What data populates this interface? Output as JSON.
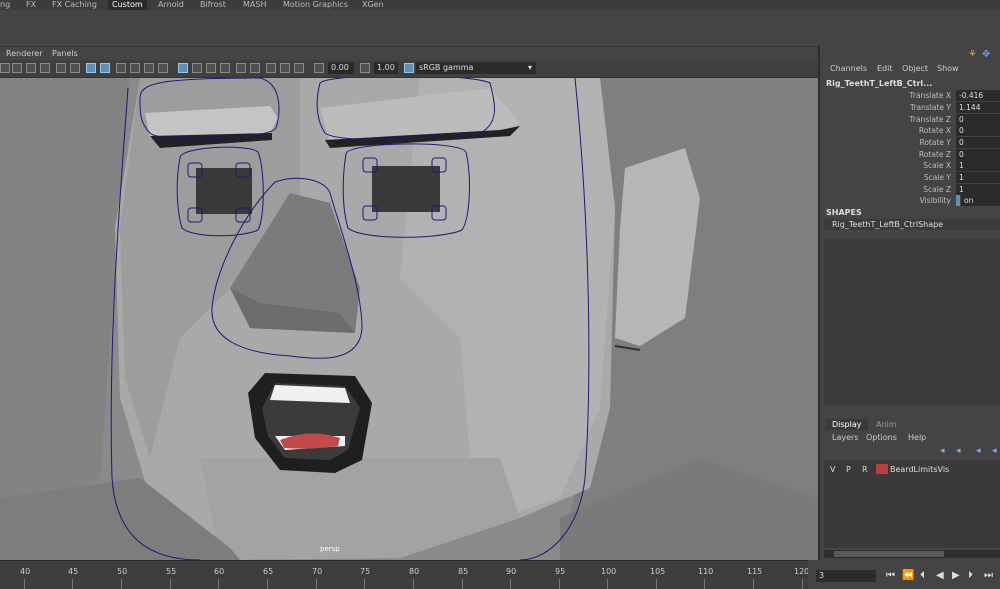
{
  "shelf_tabs": [
    "ng",
    "FX",
    "FX Caching",
    "Custom",
    "Arnold",
    "Bifrost",
    "MASH",
    "Motion Graphics",
    "XGen"
  ],
  "shelf_active": "Custom",
  "viewport_menu": [
    "Renderer",
    "Panels"
  ],
  "toolbar": {
    "exposure": "0.00",
    "gamma": "1.00",
    "color_space": "sRGB gamma"
  },
  "camera_label": "persp",
  "channel_box": {
    "menu": [
      "Channels",
      "Edit",
      "Object",
      "Show"
    ],
    "object_name": "Rig_TeethT_LeftB_Ctrl...",
    "attributes": [
      {
        "label": "Translate X",
        "value": "-0.416"
      },
      {
        "label": "Translate Y",
        "value": "1.144"
      },
      {
        "label": "Translate Z",
        "value": "0"
      },
      {
        "label": "Rotate X",
        "value": "0"
      },
      {
        "label": "Rotate Y",
        "value": "0"
      },
      {
        "label": "Rotate Z",
        "value": "0"
      },
      {
        "label": "Scale X",
        "value": "1"
      },
      {
        "label": "Scale Y",
        "value": "1"
      },
      {
        "label": "Scale Z",
        "value": "1"
      },
      {
        "label": "Visibility",
        "value": "on"
      }
    ],
    "shapes_heading": "SHAPES",
    "shape_name": "Rig_TeethT_LeftB_CtrlShape"
  },
  "layer_editor": {
    "tabs": [
      "Display",
      "Anim"
    ],
    "active_tab": "Display",
    "menu": [
      "Layers",
      "Options",
      "Help"
    ],
    "layers": [
      {
        "v": "V",
        "p": "P",
        "r": "R",
        "name": "BeardLimitsVis",
        "color": "#b84040"
      }
    ]
  },
  "timeline": {
    "ticks": [
      "40",
      "45",
      "50",
      "55",
      "60",
      "65",
      "70",
      "75",
      "80",
      "85",
      "90",
      "95",
      "100",
      "105",
      "110",
      "115",
      "120"
    ],
    "current_frame": "3"
  },
  "colors": {
    "accent": "#5d8fb8",
    "curve": "#1a1a7a",
    "layer": "#b84040"
  }
}
